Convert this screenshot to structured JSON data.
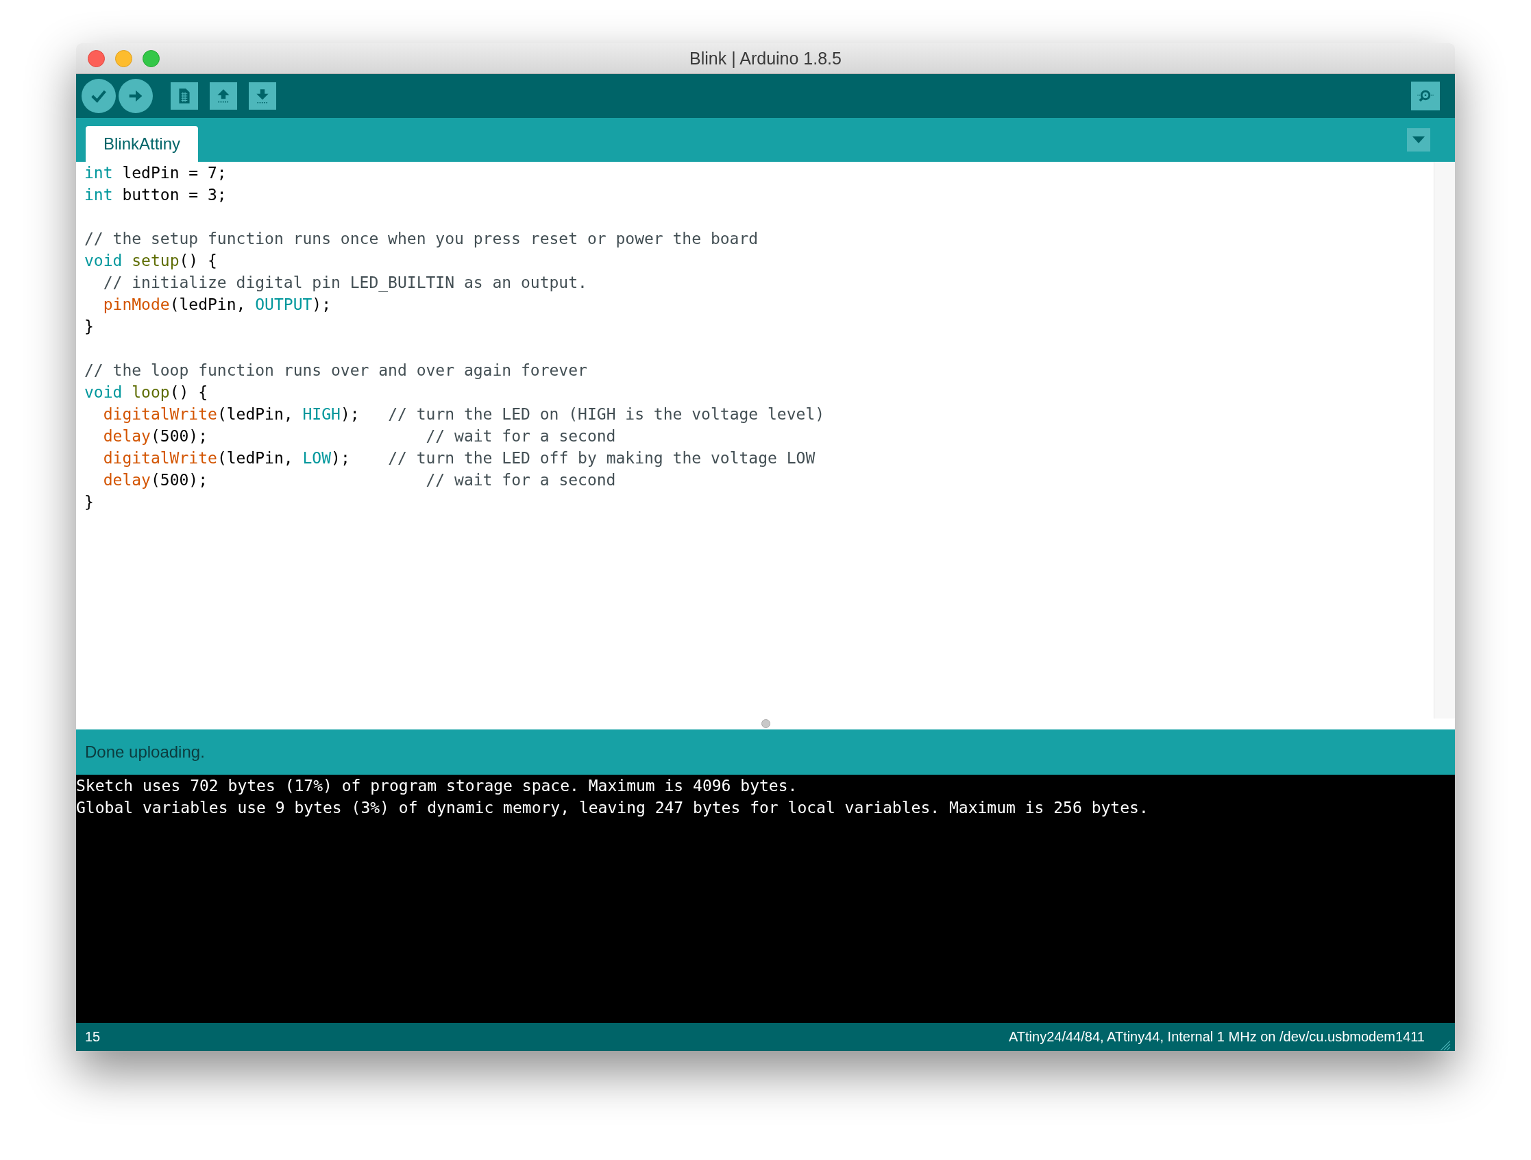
{
  "window": {
    "title": "Blink | Arduino 1.8.5"
  },
  "toolbar": {
    "buttons": [
      {
        "kind": "verify"
      },
      {
        "kind": "upload"
      },
      {
        "kind": "new"
      },
      {
        "kind": "open"
      },
      {
        "kind": "save"
      }
    ]
  },
  "tabs": [
    {
      "label": "BlinkAttiny",
      "selected": true
    }
  ],
  "editor": {
    "lines": [
      {
        "kind": "code",
        "tokens": [
          {
            "kind": "keyword",
            "text": "int"
          },
          {
            "kind": "plain",
            "text": " ledPin = 7;"
          }
        ]
      },
      {
        "kind": "code",
        "tokens": [
          {
            "kind": "keyword",
            "text": "int"
          },
          {
            "kind": "plain",
            "text": " button = 3;"
          }
        ]
      },
      {
        "kind": "blank"
      },
      {
        "kind": "code",
        "tokens": [
          {
            "kind": "comment",
            "text": "// the setup function runs once when you press reset or power the board"
          }
        ]
      },
      {
        "kind": "code",
        "tokens": [
          {
            "kind": "keyword",
            "text": "void"
          },
          {
            "kind": "structure",
            "text": " setup"
          },
          {
            "kind": "plain",
            "text": "() {"
          }
        ]
      },
      {
        "kind": "code",
        "tokens": [
          {
            "kind": "comment",
            "text": "  // initialize digital pin LED_BUILTIN as an output."
          }
        ]
      },
      {
        "kind": "code",
        "tokens": [
          {
            "kind": "function",
            "text": "  pinMode"
          },
          {
            "kind": "plain",
            "text": "(ledPin, "
          },
          {
            "kind": "constant",
            "text": "OUTPUT"
          },
          {
            "kind": "plain",
            "text": ");"
          }
        ]
      },
      {
        "kind": "code",
        "tokens": [
          {
            "kind": "plain",
            "text": "}"
          }
        ]
      },
      {
        "kind": "blank"
      },
      {
        "kind": "code",
        "tokens": [
          {
            "kind": "comment",
            "text": "// the loop function runs over and over again forever"
          }
        ]
      },
      {
        "kind": "code",
        "tokens": [
          {
            "kind": "keyword",
            "text": "void"
          },
          {
            "kind": "structure",
            "text": " loop"
          },
          {
            "kind": "plain",
            "text": "() {"
          }
        ]
      },
      {
        "kind": "code",
        "tokens": [
          {
            "kind": "function",
            "text": "  digitalWrite"
          },
          {
            "kind": "plain",
            "text": "(ledPin, "
          },
          {
            "kind": "constant",
            "text": "HIGH"
          },
          {
            "kind": "plain",
            "text": ");   "
          },
          {
            "kind": "comment",
            "text": "// turn the LED on (HIGH is the voltage level)"
          }
        ]
      },
      {
        "kind": "code",
        "tokens": [
          {
            "kind": "function",
            "text": "  delay"
          },
          {
            "kind": "plain",
            "text": "(500);                       "
          },
          {
            "kind": "comment",
            "text": "// wait for a second"
          }
        ]
      },
      {
        "kind": "code",
        "tokens": [
          {
            "kind": "function",
            "text": "  digitalWrite"
          },
          {
            "kind": "plain",
            "text": "(ledPin, "
          },
          {
            "kind": "constant",
            "text": "LOW"
          },
          {
            "kind": "plain",
            "text": ");    "
          },
          {
            "kind": "comment",
            "text": "// turn the LED off by making the voltage LOW"
          }
        ]
      },
      {
        "kind": "code",
        "tokens": [
          {
            "kind": "function",
            "text": "  delay"
          },
          {
            "kind": "plain",
            "text": "(500);                       "
          },
          {
            "kind": "comment",
            "text": "// wait for a second"
          }
        ]
      },
      {
        "kind": "code",
        "tokens": [
          {
            "kind": "plain",
            "text": "}"
          }
        ]
      }
    ]
  },
  "message": "Done uploading.",
  "console": [
    "Sketch uses 702 bytes (17%) of program storage space. Maximum is 4096 bytes.",
    "Global variables use 9 bytes (3%) of dynamic memory, leaving 247 bytes for local variables. Maximum is 256 bytes."
  ],
  "status_bar": {
    "line": "15",
    "board": "ATtiny24/44/84, ATtiny44, Internal 1 MHz on /dev/cu.usbmodem1411"
  }
}
